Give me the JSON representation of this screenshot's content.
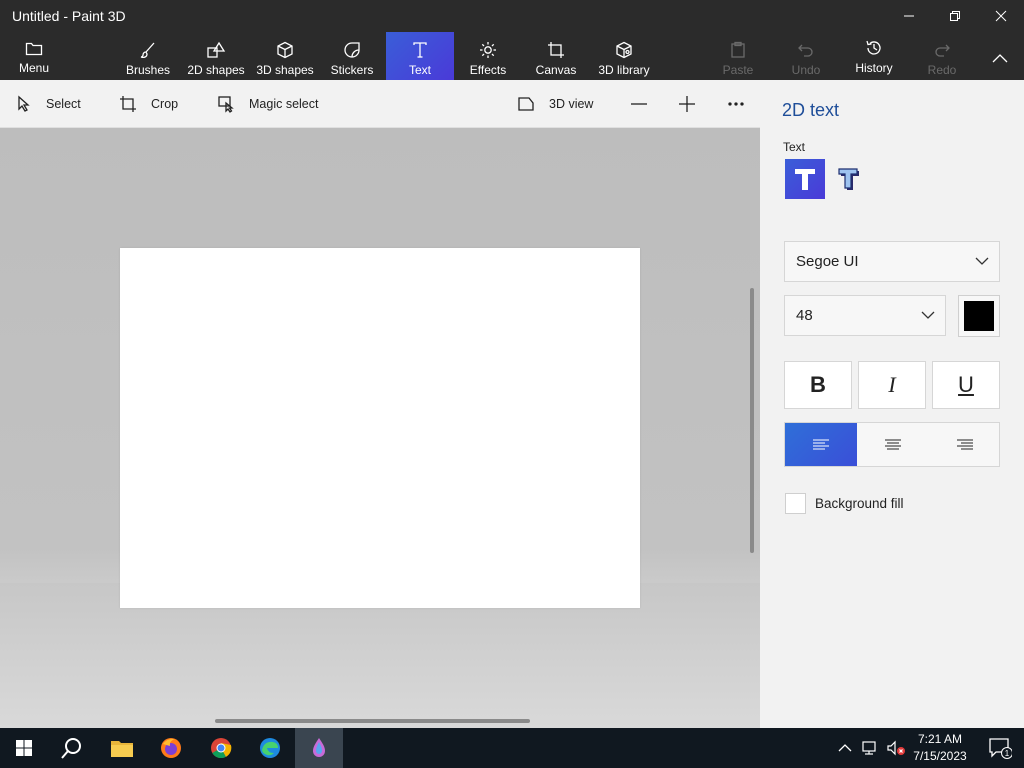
{
  "window": {
    "title": "Untitled - Paint 3D"
  },
  "ribbon": {
    "menu": "Menu",
    "brushes": "Brushes",
    "shapes2d": "2D shapes",
    "shapes3d": "3D shapes",
    "stickers": "Stickers",
    "text": "Text",
    "effects": "Effects",
    "canvas": "Canvas",
    "library3d": "3D library",
    "paste": "Paste",
    "undo": "Undo",
    "history": "History",
    "redo": "Redo"
  },
  "toolbar": {
    "select": "Select",
    "crop": "Crop",
    "magic_select": "Magic select",
    "view3d": "3D view"
  },
  "panel": {
    "title": "2D text",
    "text_label": "Text",
    "font": "Segoe UI",
    "size": "48",
    "text_color": "#000000",
    "bold": "B",
    "italic": "I",
    "underline": "U",
    "background_fill": "Background fill",
    "alignment_selected": "left"
  },
  "taskbar": {
    "time": "7:21 AM",
    "date": "7/15/2023",
    "notification_count": "1"
  },
  "colors": {
    "accent": "#3a5ed8",
    "ribbon_bg": "#2b2b2b",
    "panel_title": "#1f4e99"
  }
}
